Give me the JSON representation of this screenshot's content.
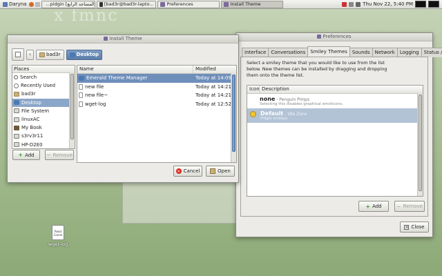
{
  "taskbar": {
    "user": "Daryna",
    "tasks": [
      {
        "label": "...pidgin [المساجد الرابع]"
      },
      {
        "label": "[bad3r@bad3r-lapto..."
      },
      {
        "label": "Preferences"
      },
      {
        "label": "Install Theme"
      }
    ],
    "clock": "Thu Nov 22, 5:40 PM"
  },
  "desktop": {
    "banner_fragment": "x fmnc",
    "icon_label": "wget-log",
    "icon_doc_text": "Read Conne"
  },
  "install_dialog": {
    "title": "Install Theme",
    "path": [
      "bad3r",
      "Desktop"
    ],
    "places_header": "Places",
    "places": [
      "Search",
      "Recently Used",
      "bad3r",
      "Desktop",
      "File System",
      "linuxAC",
      "My Book",
      "s3rv3r11",
      "HP-D2E0"
    ],
    "columns": {
      "name": "Name",
      "modified": "Modified"
    },
    "files": [
      {
        "name": "Emerald Theme Manager",
        "modified": "Today at 14:09"
      },
      {
        "name": "new file",
        "modified": "Today at 14:21"
      },
      {
        "name": "new file~",
        "modified": "Today at 14:21"
      },
      {
        "name": "wget-log",
        "modified": "Today at 12:52"
      }
    ],
    "add_label": "Add",
    "remove_label": "Remove",
    "cancel_label": "Cancel",
    "open_label": "Open"
  },
  "preferences": {
    "title": "Preferences",
    "tabs": [
      "Interface",
      "Conversations",
      "Smiley Themes",
      "Sounds",
      "Network",
      "Logging",
      "Status / Idle"
    ],
    "description": "Select a smiley theme that you would like to use from the list below. New themes can be installed by dragging and dropping them onto the theme list.",
    "columns": {
      "icon": "Icon",
      "description": "Description"
    },
    "themes": [
      {
        "name": "none",
        "author": " - Penguin Pimps",
        "desc": "Selecting this disables graphical emoticons."
      },
      {
        "name": "Default",
        "author": " - Idle Zone",
        "desc": "Pidgin smileys"
      }
    ],
    "add_label": "Add",
    "remove_label": "Remove",
    "close_label": "Close"
  }
}
